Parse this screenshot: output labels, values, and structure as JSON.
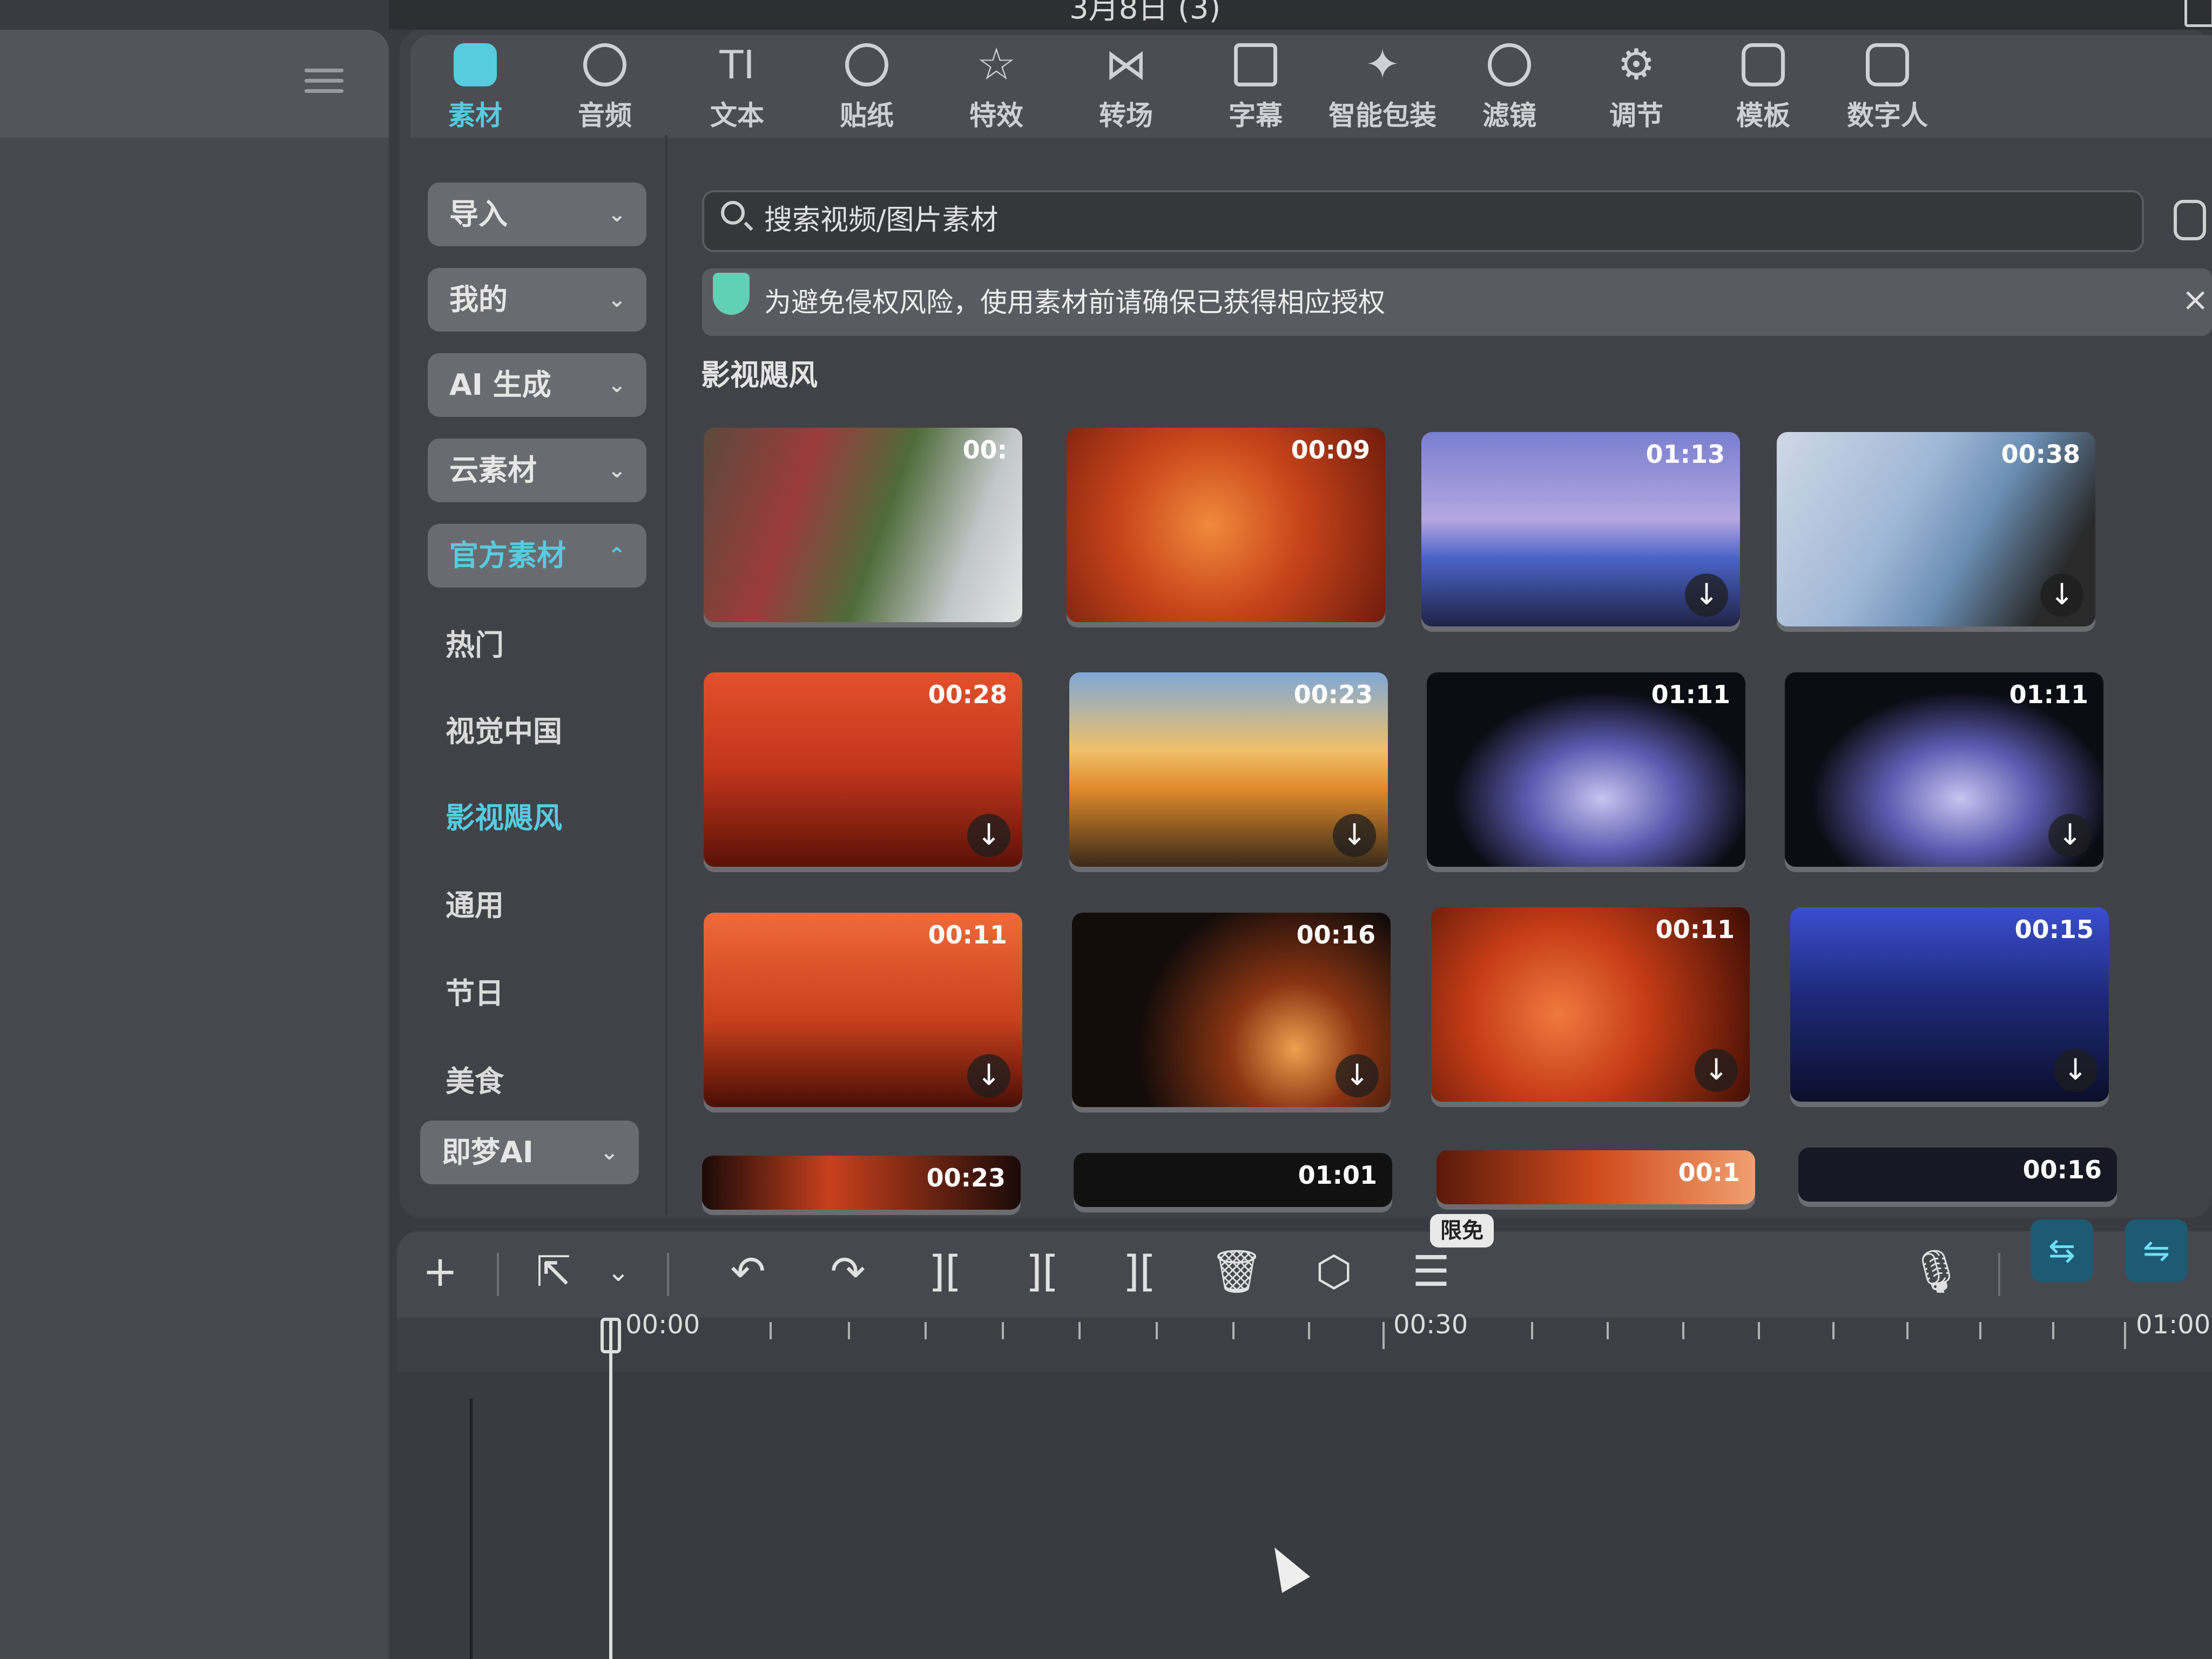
{
  "window": {
    "title": "3月8日 (3)"
  },
  "toolbar": {
    "tabs": [
      {
        "label": "素材",
        "active": true,
        "icon": "media-icon"
      },
      {
        "label": "音频",
        "active": false,
        "icon": "audio-icon"
      },
      {
        "label": "文本",
        "active": false,
        "icon": "text-icon"
      },
      {
        "label": "贴纸",
        "active": false,
        "icon": "sticker-icon"
      },
      {
        "label": "特效",
        "active": false,
        "icon": "effects-icon"
      },
      {
        "label": "转场",
        "active": false,
        "icon": "transition-icon"
      },
      {
        "label": "字幕",
        "active": false,
        "icon": "subtitle-icon"
      },
      {
        "label": "智能包装",
        "active": false,
        "icon": "smart-package-icon"
      },
      {
        "label": "滤镜",
        "active": false,
        "icon": "filter-icon"
      },
      {
        "label": "调节",
        "active": false,
        "icon": "adjust-icon"
      },
      {
        "label": "模板",
        "active": false,
        "icon": "template-icon"
      },
      {
        "label": "数字人",
        "active": false,
        "icon": "digital-human-icon"
      }
    ]
  },
  "sidebar": {
    "groups": [
      {
        "label": "导入",
        "open": false
      },
      {
        "label": "我的",
        "open": false
      },
      {
        "label": "AI 生成",
        "open": false
      },
      {
        "label": "云素材",
        "open": false
      },
      {
        "label": "官方素材",
        "open": true
      }
    ],
    "sub_items": [
      {
        "label": "热门",
        "selected": false
      },
      {
        "label": "视觉中国",
        "selected": false
      },
      {
        "label": "影视飓风",
        "selected": true
      },
      {
        "label": "通用",
        "selected": false
      },
      {
        "label": "节日",
        "selected": false
      },
      {
        "label": "美食",
        "selected": false
      }
    ],
    "bottom_group": {
      "label": "即梦AI",
      "open": false
    }
  },
  "search": {
    "placeholder": "搜索视频/图片素材"
  },
  "notice": {
    "text": "为避免侵权风险，使用素材前请确保已获得相应授权",
    "close": "×"
  },
  "section": {
    "title": "影视飓风"
  },
  "thumbnails": [
    {
      "duration": "00:",
      "download": false,
      "scene": "two-women-rocks"
    },
    {
      "duration": "00:09",
      "download": false,
      "scene": "woman-orange"
    },
    {
      "duration": "01:13",
      "download": true,
      "scene": "beach-dancer-blue"
    },
    {
      "duration": "00:38",
      "download": true,
      "scene": "beach-dancer-cave"
    },
    {
      "duration": "00:28",
      "download": true,
      "scene": "face-red"
    },
    {
      "duration": "00:23",
      "download": true,
      "scene": "sunset-coast"
    },
    {
      "duration": "01:11",
      "download": false,
      "scene": "cave-silhouette"
    },
    {
      "duration": "01:11",
      "download": true,
      "scene": "cave-silhouette"
    },
    {
      "duration": "00:11",
      "download": true,
      "scene": "lips-red"
    },
    {
      "duration": "00:16",
      "download": true,
      "scene": "fire-dancer-dark"
    },
    {
      "duration": "00:11",
      "download": true,
      "scene": "nose-red"
    },
    {
      "duration": "00:15",
      "download": true,
      "scene": "night-beach-fire"
    },
    {
      "duration": "00:23",
      "download": false,
      "scene": "partial-fire"
    },
    {
      "duration": "01:01",
      "download": false,
      "scene": "partial-dark"
    },
    {
      "duration": "00:1",
      "download": false,
      "scene": "partial-red"
    },
    {
      "duration": "00:16",
      "download": false,
      "scene": "partial-night"
    }
  ],
  "timeline": {
    "free_badge": "限免",
    "ruler": {
      "labels": [
        "00:00",
        "00:30",
        "01:00"
      ]
    }
  },
  "colors": {
    "accent": "#57cbe0",
    "panel": "#414247",
    "notice_shield": "#62d0b4"
  }
}
